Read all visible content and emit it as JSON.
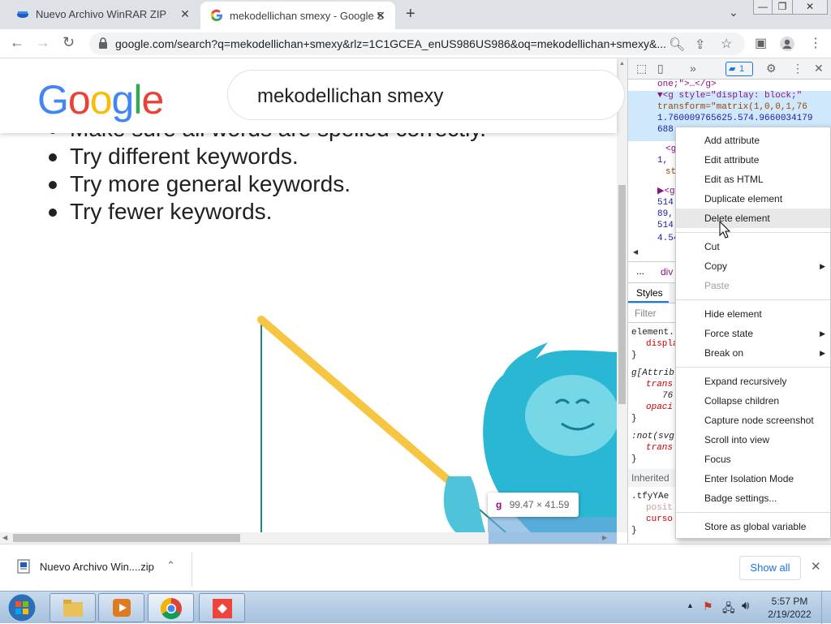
{
  "tabs": [
    {
      "title": "Nuevo Archivo WinRAR ZIP",
      "active": false
    },
    {
      "title": "mekodellichan smexy - Google S",
      "active": true
    }
  ],
  "window_controls": {
    "minimize": "—",
    "maximize": "❐",
    "close": "✕"
  },
  "address_bar": {
    "url": "google.com/search?q=mekodellichan+smexy&rlz=1C1GCEA_enUS986US986&oq=mekodellichan+smexy&..."
  },
  "page": {
    "logo": [
      {
        "ch": "G",
        "color": "#4285F4"
      },
      {
        "ch": "o",
        "color": "#EA4335"
      },
      {
        "ch": "o",
        "color": "#FBBC05"
      },
      {
        "ch": "g",
        "color": "#4285F4"
      },
      {
        "ch": "l",
        "color": "#34A853"
      },
      {
        "ch": "e",
        "color": "#EA4335"
      }
    ],
    "search_query": "mekodellichan smexy",
    "tips_partial": "Make sure all words are spelled correctly.",
    "tips": [
      "Try different keywords.",
      "Try more general keywords.",
      "Try fewer keywords."
    ],
    "element_tooltip": {
      "tag": "g",
      "size": "99.47 × 41.59"
    }
  },
  "devtools": {
    "issues_count": "1",
    "dom_lines": [
      "one;\">…</g>",
      "▼<g style=\"display: block;\"",
      "transform=\"matrix(1,0,0,1,76",
      "1.760009765625.574.9660034179",
      "688",
      "<g",
      "1,",
      "st",
      "▶<g",
      "514",
      "89,",
      "514",
      "4.54"
    ],
    "breadcrumb": [
      "...",
      "div"
    ],
    "styles_tab": "Styles",
    "filter_placeholder": "Filter",
    "style_rules": [
      "element.",
      "displa",
      "}",
      "g[Attrib",
      "trans",
      "76",
      "opaci",
      "}",
      ":not(svg",
      "trans",
      "}",
      "Inherited",
      ".tfyYAe",
      "posit",
      "curso",
      "}"
    ]
  },
  "context_menu": {
    "items": [
      {
        "label": "Add attribute",
        "state": "normal"
      },
      {
        "label": "Edit attribute",
        "state": "normal"
      },
      {
        "label": "Edit as HTML",
        "state": "normal"
      },
      {
        "label": "Duplicate element",
        "state": "normal"
      },
      {
        "label": "Delete element",
        "state": "hover"
      },
      {
        "label": "Cut",
        "state": "normal"
      },
      {
        "label": "Copy",
        "state": "submenu"
      },
      {
        "label": "Paste",
        "state": "disabled"
      },
      {
        "label": "Hide element",
        "state": "normal"
      },
      {
        "label": "Force state",
        "state": "submenu"
      },
      {
        "label": "Break on",
        "state": "submenu"
      },
      {
        "label": "Expand recursively",
        "state": "normal"
      },
      {
        "label": "Collapse children",
        "state": "normal"
      },
      {
        "label": "Capture node screenshot",
        "state": "normal"
      },
      {
        "label": "Scroll into view",
        "state": "normal"
      },
      {
        "label": "Focus",
        "state": "normal"
      },
      {
        "label": "Enter Isolation Mode",
        "state": "normal"
      },
      {
        "label": "Badge settings...",
        "state": "normal"
      },
      {
        "label": "Store as global variable",
        "state": "normal"
      }
    ]
  },
  "download_bar": {
    "file_name": "Nuevo Archivo Win....zip",
    "show_all": "Show all"
  },
  "taskbar": {
    "time": "5:57 PM",
    "date": "2/19/2022"
  },
  "colors": {
    "accent": "#1a73e8",
    "character_body": "#2ab7d4",
    "fishing_rod": "#f6c542"
  }
}
